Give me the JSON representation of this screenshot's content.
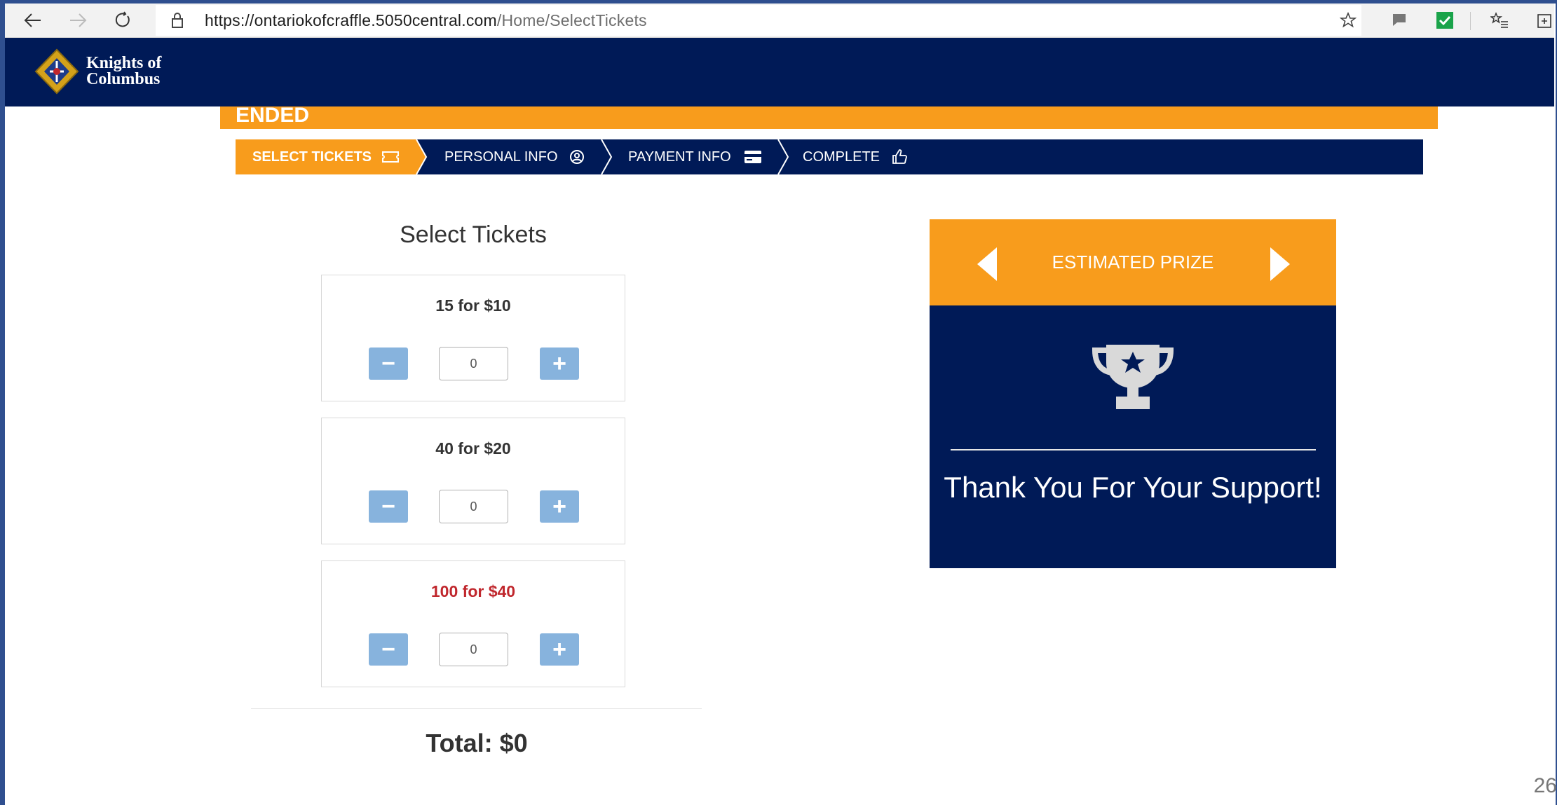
{
  "browser": {
    "url_host": "https://ontariokofcraffle.5050central.com",
    "url_path": "/Home/SelectTickets"
  },
  "header": {
    "logo_line1": "Knights of",
    "logo_line2": "Columbus"
  },
  "banner": {
    "status": "ENDED"
  },
  "steps": [
    {
      "label": "SELECT TICKETS",
      "icon": "ticket-icon",
      "active": true
    },
    {
      "label": "PERSONAL INFO",
      "icon": "user-circle-icon",
      "active": false
    },
    {
      "label": "PAYMENT INFO",
      "icon": "credit-card-icon",
      "active": false
    },
    {
      "label": "COMPLETE",
      "icon": "thumbs-up-icon",
      "active": false
    }
  ],
  "tickets": {
    "title": "Select Tickets",
    "packages": [
      {
        "label": "15 for $10",
        "quantity": "0",
        "minus": "−",
        "plus": "+"
      },
      {
        "label": "40 for $20",
        "quantity": "0",
        "minus": "−",
        "plus": "+"
      },
      {
        "label": "100 for $40",
        "quantity": "0",
        "minus": "−",
        "plus": "+"
      }
    ],
    "total": "Total: $0"
  },
  "prize": {
    "title": "ESTIMATED PRIZE",
    "message": "Thank You For Your Support!",
    "icon": "trophy-icon"
  },
  "slide": {
    "number": "26"
  },
  "colors": {
    "navy": "#001a57",
    "orange": "#f89c1c",
    "qty_button": "#87b3dd",
    "highlight_red": "#c0272d"
  }
}
